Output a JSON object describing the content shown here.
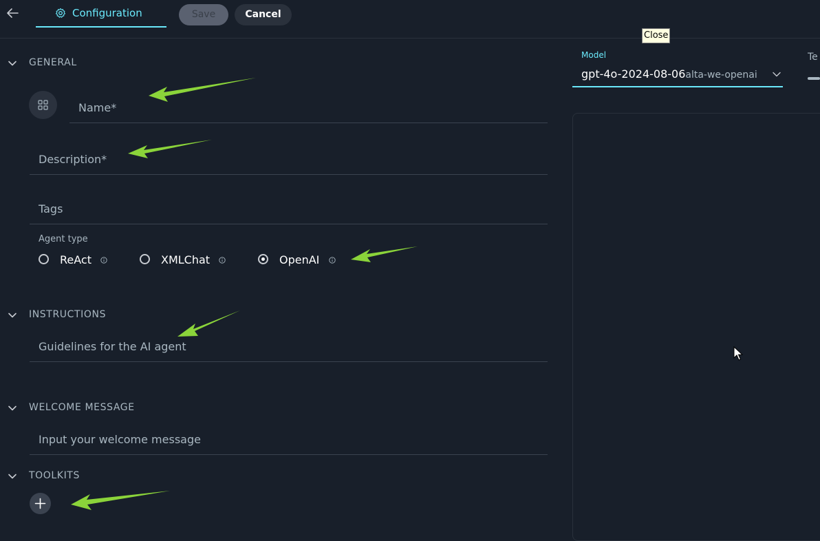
{
  "header": {
    "tab_label": "Configuration",
    "save_label": "Save",
    "cancel_label": "Cancel"
  },
  "tooltip": "Close",
  "general": {
    "title": "GENERAL",
    "name_placeholder": "Name*",
    "description_placeholder": "Description*",
    "tags_placeholder": "Tags",
    "agent_type_label": "Agent type",
    "agent_types": [
      {
        "label": "ReAct",
        "selected": false
      },
      {
        "label": "XMLChat",
        "selected": false
      },
      {
        "label": "OpenAI",
        "selected": true
      }
    ]
  },
  "instructions": {
    "title": "INSTRUCTIONS",
    "placeholder": "Guidelines for the AI agent"
  },
  "welcome": {
    "title": "WELCOME MESSAGE",
    "placeholder": "Input your welcome message"
  },
  "toolkits": {
    "title": "TOOLKITS"
  },
  "model": {
    "label": "Model",
    "value": "gpt-4o-2024-08-06",
    "provider": "alta-we-openai"
  },
  "temperature": {
    "label_visible": "Te"
  },
  "colors": {
    "background": "#181F2A",
    "accent": "#6AE8FA",
    "muted_text": "#A9B7C1",
    "annotation_arrow": "#8BD43A"
  }
}
